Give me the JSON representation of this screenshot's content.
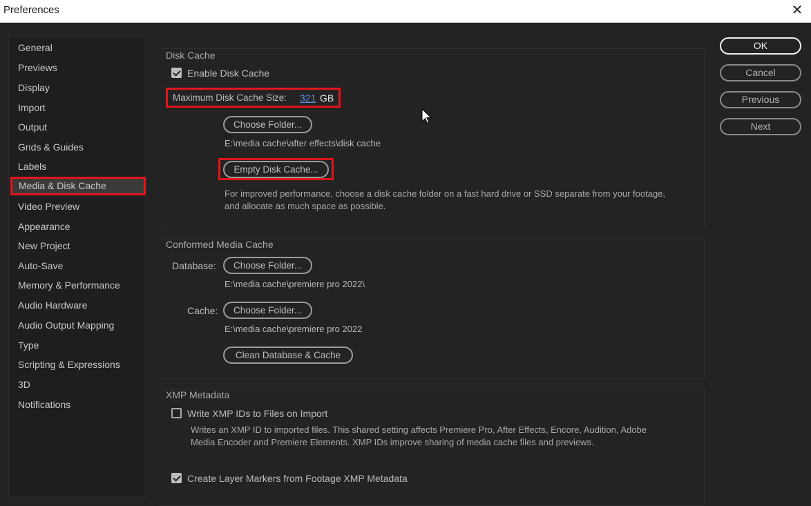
{
  "window": {
    "title": "Preferences",
    "close_icon": "close-icon"
  },
  "sidebar": {
    "items": [
      {
        "label": "General"
      },
      {
        "label": "Previews"
      },
      {
        "label": "Display"
      },
      {
        "label": "Import"
      },
      {
        "label": "Output"
      },
      {
        "label": "Grids & Guides"
      },
      {
        "label": "Labels"
      },
      {
        "label": "Media & Disk Cache",
        "selected": true
      },
      {
        "label": "Video Preview"
      },
      {
        "label": "Appearance"
      },
      {
        "label": "New Project"
      },
      {
        "label": "Auto-Save"
      },
      {
        "label": "Memory & Performance"
      },
      {
        "label": "Audio Hardware"
      },
      {
        "label": "Audio Output Mapping"
      },
      {
        "label": "Type"
      },
      {
        "label": "Scripting & Expressions"
      },
      {
        "label": "3D"
      },
      {
        "label": "Notifications"
      }
    ]
  },
  "disk_cache": {
    "title": "Disk Cache",
    "enable_label": "Enable Disk Cache",
    "enable_checked": true,
    "max_size_label": "Maximum Disk Cache Size:",
    "max_size_value": "321",
    "max_size_unit": "GB",
    "choose_folder_label": "Choose Folder...",
    "folder_path": "E:\\media cache\\after effects\\disk cache",
    "empty_label": "Empty Disk Cache...",
    "hint_line1": "For improved performance, choose a disk cache folder on a fast hard drive or SSD separate from your footage,",
    "hint_line2": "and allocate as much space as possible."
  },
  "conformed": {
    "title": "Conformed Media Cache",
    "database_label": "Database:",
    "database_button": "Choose Folder...",
    "database_path": "E:\\media cache\\premiere pro 2022\\",
    "cache_label": "Cache:",
    "cache_button": "Choose Folder...",
    "cache_path": "E:\\media cache\\premiere pro 2022",
    "clean_label": "Clean Database & Cache"
  },
  "xmp": {
    "title": "XMP Metadata",
    "write_label": "Write XMP IDs to Files on Import",
    "write_checked": false,
    "desc_line1": "Writes an XMP ID to imported files. This shared setting affects Premiere Pro, After Effects, Encore, Audition, Adobe",
    "desc_line2": "Media Encoder and Premiere Elements. XMP IDs improve sharing of media cache files and previews.",
    "markers_label": "Create Layer Markers from Footage XMP Metadata",
    "markers_checked": true
  },
  "actions": {
    "ok": "OK",
    "cancel": "Cancel",
    "previous": "Previous",
    "next": "Next"
  },
  "colors": {
    "accent_highlight": "#e0161e",
    "background": "#232323",
    "value_blue": "#5b8fd9"
  },
  "cursor_icon": "mouse-pointer-icon"
}
